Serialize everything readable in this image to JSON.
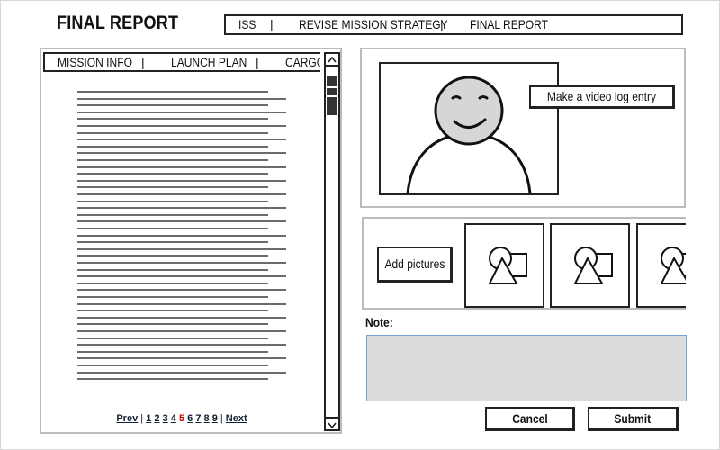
{
  "page": {
    "title": "FINAL REPORT"
  },
  "topnav": {
    "items": [
      "ISS",
      "REVISE MISSION STRATEGY",
      "FINAL REPORT"
    ],
    "separator": "|"
  },
  "document": {
    "tabs": [
      "MISSION INFO",
      "LAUNCH PLAN",
      "CARGO"
    ],
    "separator": "|",
    "scroll_up_icon": "chevron-up-icon",
    "scroll_down_icon": "chevron-down-icon",
    "pagination": {
      "prev": "Prev",
      "pages": [
        "1",
        "2",
        "3",
        "4",
        "5",
        "6",
        "7",
        "8",
        "9"
      ],
      "current": "5",
      "next": "Next",
      "divider": "|"
    }
  },
  "video": {
    "button_label": "Make a video log entry",
    "placeholder_icon": "avatar-face-icon"
  },
  "pictures": {
    "add_button_label": "Add pictures",
    "thumbnail_icon": "image-placeholder-icon"
  },
  "note": {
    "label": "Note:",
    "value": "",
    "placeholder": ""
  },
  "actions": {
    "cancel_label": "Cancel",
    "submit_label": "Submit"
  }
}
